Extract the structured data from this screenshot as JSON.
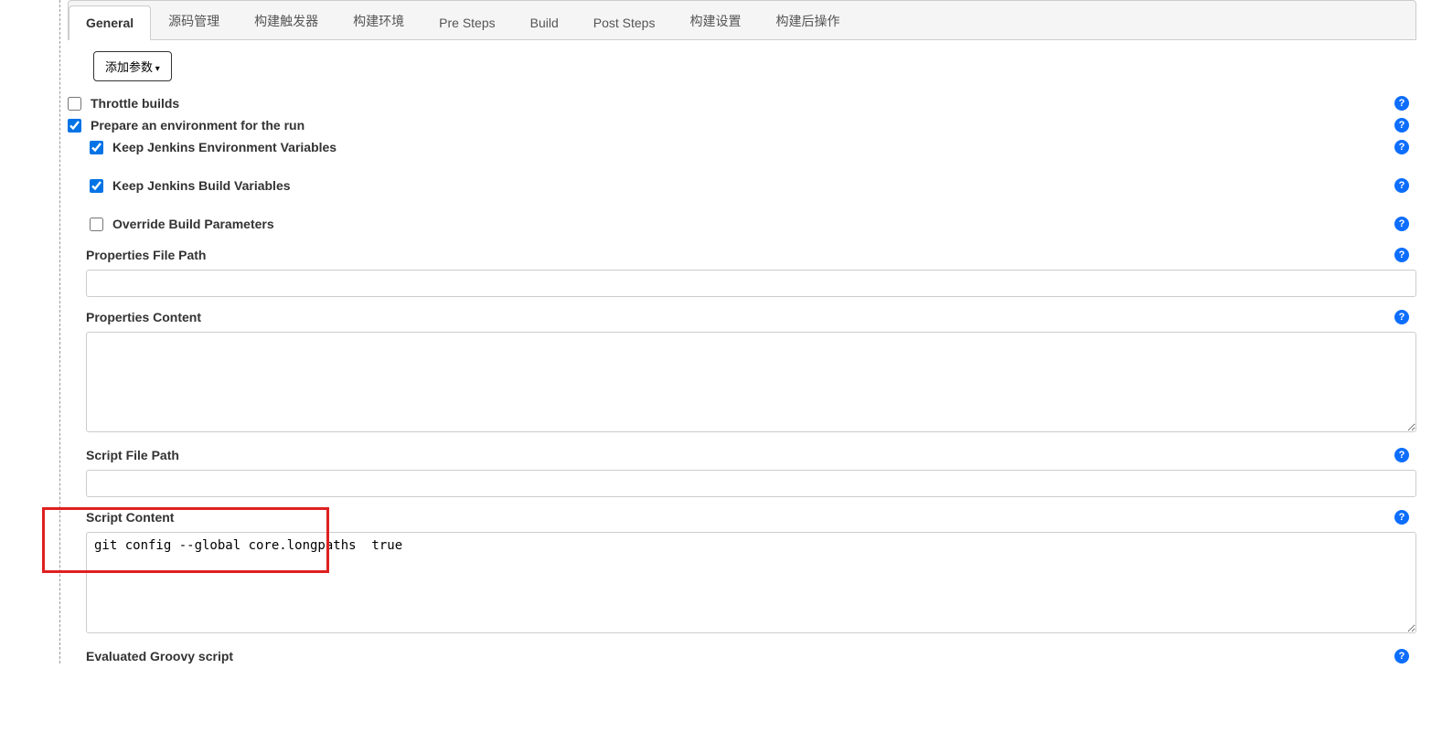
{
  "tabs": {
    "items": [
      {
        "label": "General",
        "active": true
      },
      {
        "label": "源码管理",
        "active": false
      },
      {
        "label": "构建触发器",
        "active": false
      },
      {
        "label": "构建环境",
        "active": false
      },
      {
        "label": "Pre Steps",
        "active": false
      },
      {
        "label": "Build",
        "active": false
      },
      {
        "label": "Post Steps",
        "active": false
      },
      {
        "label": "构建设置",
        "active": false
      },
      {
        "label": "构建后操作",
        "active": false
      }
    ]
  },
  "addParamBtn": "添加参数",
  "options": {
    "throttle": {
      "label": "Throttle builds",
      "checked": false
    },
    "prepareEnv": {
      "label": "Prepare an environment for the run",
      "checked": true
    },
    "keepEnvVars": {
      "label": "Keep Jenkins Environment Variables",
      "checked": true
    },
    "keepBuildVars": {
      "label": "Keep Jenkins Build Variables",
      "checked": true
    },
    "overrideParams": {
      "label": "Override Build Parameters",
      "checked": false
    }
  },
  "fields": {
    "propFilePath": {
      "label": "Properties File Path",
      "value": ""
    },
    "propContent": {
      "label": "Properties Content",
      "value": ""
    },
    "scriptFilePath": {
      "label": "Script File Path",
      "value": ""
    },
    "scriptContent": {
      "label": "Script Content",
      "value": "git config --global core.longpaths  true\n"
    },
    "evalGroovy": {
      "label": "Evaluated Groovy script",
      "value": ""
    }
  },
  "helpGlyph": "?"
}
